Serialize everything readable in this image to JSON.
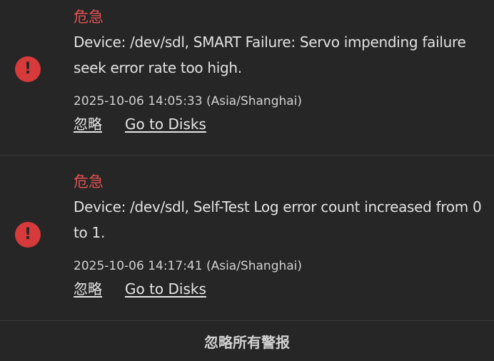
{
  "alerts": [
    {
      "severity": "危急",
      "message": "Device: /dev/sdl, SMART Failure: Servo impending failure seek error rate too high.",
      "timestamp": "2025-10-06 14:05:33 (Asia/Shanghai)",
      "dismiss_label": "忽略",
      "goto_label": "Go to Disks",
      "icon": "alert-circle-icon"
    },
    {
      "severity": "危急",
      "message": "Device: /dev/sdl, Self-Test Log error count increased from 0 to 1.",
      "timestamp": "2025-10-06 14:17:41 (Asia/Shanghai)",
      "dismiss_label": "忽略",
      "goto_label": "Go to Disks",
      "icon": "alert-circle-icon"
    }
  ],
  "footer": {
    "dismiss_all_label": "忽略所有警报"
  },
  "colors": {
    "background": "#262626",
    "critical": "#d73a3a",
    "text": "#dcdcdc"
  }
}
